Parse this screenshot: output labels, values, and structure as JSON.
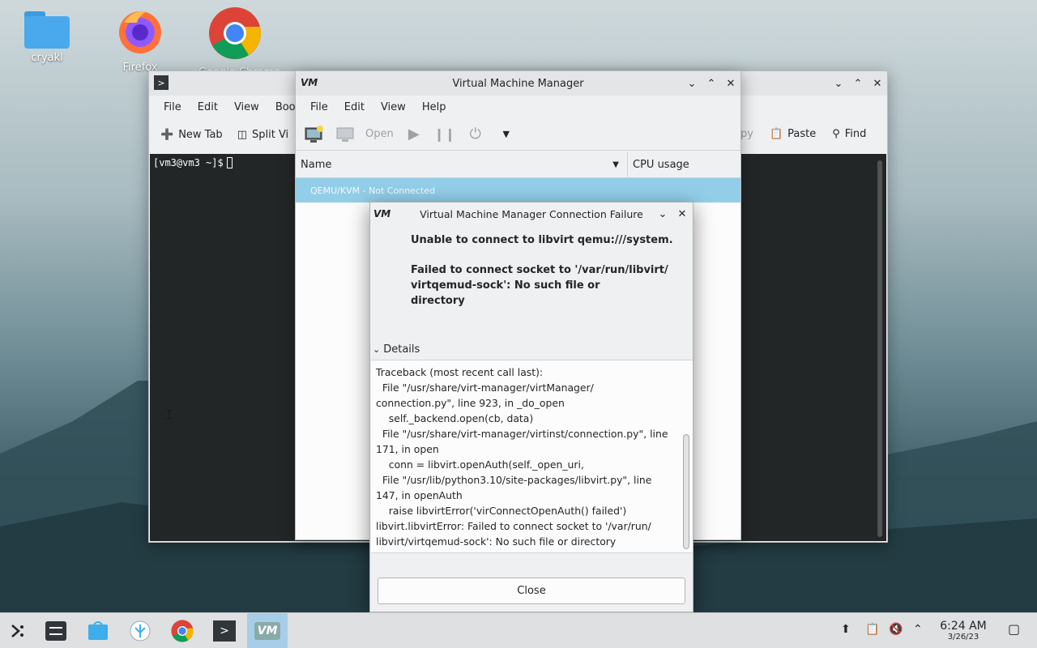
{
  "desktop": {
    "icons": [
      {
        "label": "cryakl",
        "icon": "folder-icon"
      },
      {
        "label": "Firefox",
        "icon": "firefox-icon"
      },
      {
        "label": "Google Chrome",
        "icon": "chrome-icon"
      }
    ]
  },
  "terminal": {
    "menu": [
      "File",
      "Edit",
      "View",
      "Bookm"
    ],
    "toolbar": {
      "new_tab": "New Tab",
      "split_view": "Split Vi",
      "copy": "py",
      "paste": "Paste",
      "find": "Find"
    },
    "prompt": "[vm3@vm3 ~]$"
  },
  "vmm": {
    "title": "Virtual Machine Manager",
    "menu": [
      "File",
      "Edit",
      "View",
      "Help"
    ],
    "toolbar": {
      "open": "Open"
    },
    "columns": {
      "name": "Name",
      "cpu": "CPU usage"
    },
    "row": "QEMU/KVM - Not Connected"
  },
  "dialog": {
    "title": "Virtual Machine Manager Connection Failure",
    "message_line1": "Unable to connect to libvirt qemu:///system.",
    "message_line2": "Failed to connect socket to '/var/run/libvirt/",
    "message_line3": "virtqemud-sock': No such file or",
    "message_line4": "directory",
    "details_label": "Details",
    "traceback": "Traceback (most recent call last):\n  File \"/usr/share/virt-manager/virtManager/\nconnection.py\", line 923, in _do_open\n    self._backend.open(cb, data)\n  File \"/usr/share/virt-manager/virtinst/connection.py\", line\n171, in open\n    conn = libvirt.openAuth(self._open_uri,\n  File \"/usr/lib/python3.10/site-packages/libvirt.py\", line\n147, in openAuth\n    raise libvirtError('virConnectOpenAuth() failed')\nlibvirt.libvirtError: Failed to connect socket to '/var/run/\nlibvirt/virtqemud-sock': No such file or directory",
    "close_label": "Close"
  },
  "taskbar": {
    "time": "6:24 AM",
    "date": "3/26/23"
  },
  "colors": {
    "selection": "#93cee9",
    "terminal_bg": "#232627",
    "accent": "#3daee9"
  }
}
